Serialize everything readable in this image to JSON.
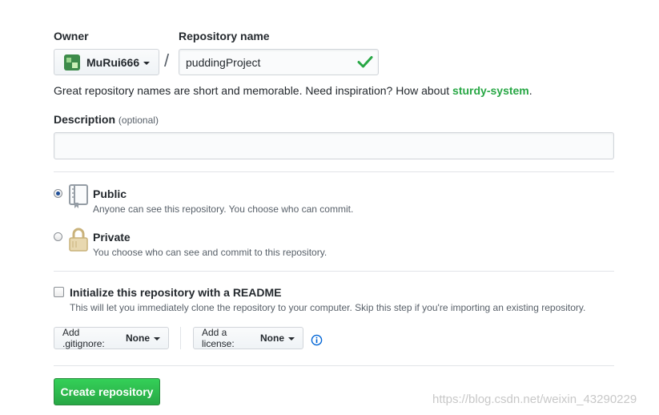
{
  "owner": {
    "label": "Owner",
    "name": "MuRui666"
  },
  "separator": "/",
  "repo": {
    "label": "Repository name",
    "value": "puddingProject"
  },
  "hint": {
    "text": "Great repository names are short and memorable. Need inspiration? How about ",
    "suggestion": "sturdy-system",
    "end": "."
  },
  "description": {
    "label": "Description",
    "optional": "(optional)",
    "value": ""
  },
  "visibility": {
    "public": {
      "title": "Public",
      "note": "Anyone can see this repository. You choose who can commit.",
      "selected": true
    },
    "private": {
      "title": "Private",
      "note": "You choose who can see and commit to this repository.",
      "selected": false
    }
  },
  "init": {
    "title": "Initialize this repository with a README",
    "note": "This will let you immediately clone the repository to your computer. Skip this step if you're importing an existing repository.",
    "checked": false
  },
  "gitignore": {
    "label": "Add .gitignore:",
    "value": "None"
  },
  "license": {
    "label": "Add a license:",
    "value": "None"
  },
  "create_button": "Create repository",
  "watermark": "https://blog.csdn.net/weixin_43290229",
  "colors": {
    "accent_green": "#28a745",
    "radio_blue": "#1f4f99",
    "lock_gold": "#c9b27b",
    "info_blue": "#0366d6"
  }
}
